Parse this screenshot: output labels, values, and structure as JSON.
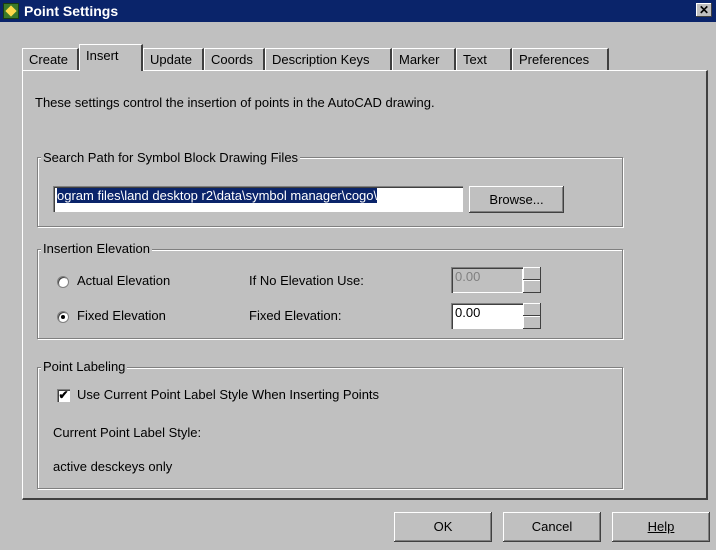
{
  "window": {
    "title": "Point Settings",
    "close": "✕"
  },
  "tabs": [
    "Create",
    "Insert",
    "Update",
    "Coords",
    "Description Keys",
    "Marker",
    "Text",
    "Preferences"
  ],
  "description": "These settings control the insertion of points in the AutoCAD drawing.",
  "search_path": {
    "legend": "Search Path for Symbol Block Drawing Files",
    "value": "ogram files\\land desktop r2\\data\\symbol manager\\cogo\\",
    "browse_label": "Browse..."
  },
  "elevation": {
    "legend": "Insertion Elevation",
    "actual_label": "Actual Elevation",
    "fixed_label": "Fixed Elevation",
    "no_elev_label": "If No Elevation Use:",
    "no_elev_value": "0.00",
    "fixed_elev_label": "Fixed Elevation:",
    "fixed_elev_value": "0.00"
  },
  "labeling": {
    "legend": "Point Labeling",
    "use_current_label": "Use Current Point Label Style When Inserting Points",
    "current_style_label": "Current Point Label Style:",
    "current_style_value": "active desckeys only"
  },
  "footer": {
    "ok": "OK",
    "cancel": "Cancel",
    "help": "Help"
  }
}
